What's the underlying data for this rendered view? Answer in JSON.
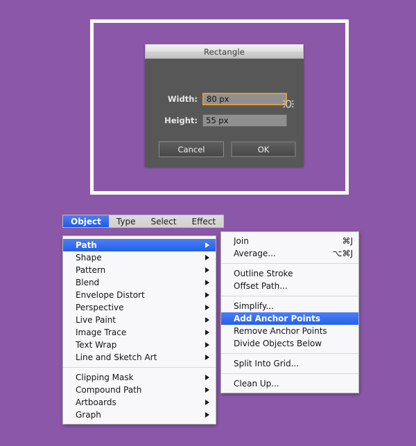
{
  "canvas": {
    "background_color": "#8b58a9",
    "frame_border_color": "#ffffff"
  },
  "dialog": {
    "title": "Rectangle",
    "fields": [
      {
        "label": "Width:",
        "value": "80 px",
        "focused": true
      },
      {
        "label": "Height:",
        "value": "55 px",
        "focused": false
      }
    ],
    "constrain_icon": "constrain-proportions-icon",
    "buttons": [
      {
        "label": "Cancel",
        "primary": false
      },
      {
        "label": "OK",
        "primary": true
      }
    ],
    "colors": {
      "body": "#575757",
      "input": "#8f8f8f",
      "focus_border": "#e09a3e"
    }
  },
  "menubar": {
    "items": [
      {
        "label": "Object",
        "active": true
      },
      {
        "label": "Type",
        "active": false
      },
      {
        "label": "Select",
        "active": false
      },
      {
        "label": "Effect",
        "active": false
      }
    ],
    "highlight_color": "#2560ea"
  },
  "object_menu": {
    "items": [
      {
        "label": "Path",
        "submenu": true,
        "highlighted": true
      },
      {
        "label": "Shape",
        "submenu": true,
        "highlighted": false
      },
      {
        "label": "Pattern",
        "submenu": true,
        "highlighted": false
      },
      {
        "label": "Blend",
        "submenu": true,
        "highlighted": false
      },
      {
        "label": "Envelope Distort",
        "submenu": true,
        "highlighted": false
      },
      {
        "label": "Perspective",
        "submenu": true,
        "highlighted": false
      },
      {
        "label": "Live Paint",
        "submenu": true,
        "highlighted": false
      },
      {
        "label": "Image Trace",
        "submenu": true,
        "highlighted": false
      },
      {
        "label": "Text Wrap",
        "submenu": true,
        "highlighted": false
      },
      {
        "label": "Line and Sketch Art",
        "submenu": true,
        "highlighted": false
      },
      {
        "separator": true
      },
      {
        "label": "Clipping Mask",
        "submenu": true,
        "highlighted": false
      },
      {
        "label": "Compound Path",
        "submenu": true,
        "highlighted": false
      },
      {
        "label": "Artboards",
        "submenu": true,
        "highlighted": false
      },
      {
        "label": "Graph",
        "submenu": true,
        "highlighted": false
      }
    ]
  },
  "path_submenu": {
    "items": [
      {
        "label": "Join",
        "shortcut": "⌘J",
        "highlighted": false
      },
      {
        "label": "Average...",
        "shortcut": "⌥⌘J",
        "highlighted": false
      },
      {
        "separator": true
      },
      {
        "label": "Outline Stroke",
        "shortcut": "",
        "highlighted": false
      },
      {
        "label": "Offset Path...",
        "shortcut": "",
        "highlighted": false
      },
      {
        "separator": true
      },
      {
        "label": "Simplify...",
        "shortcut": "",
        "highlighted": false
      },
      {
        "label": "Add Anchor Points",
        "shortcut": "",
        "highlighted": true
      },
      {
        "label": "Remove Anchor Points",
        "shortcut": "",
        "highlighted": false
      },
      {
        "label": "Divide Objects Below",
        "shortcut": "",
        "highlighted": false
      },
      {
        "separator": true
      },
      {
        "label": "Split Into Grid...",
        "shortcut": "",
        "highlighted": false
      },
      {
        "separator": true
      },
      {
        "label": "Clean Up...",
        "shortcut": "",
        "highlighted": false
      }
    ]
  }
}
